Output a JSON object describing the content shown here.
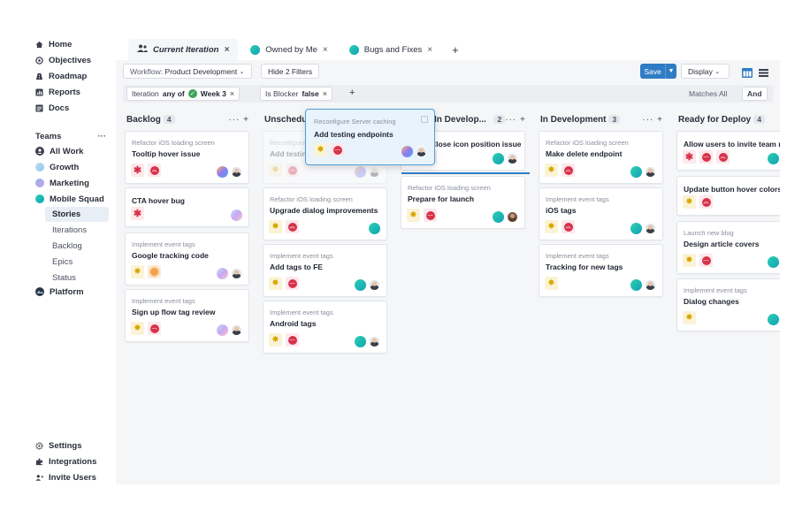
{
  "sidebar": {
    "nav": [
      {
        "label": "Home",
        "icon": "home-icon"
      },
      {
        "label": "Objectives",
        "icon": "target-icon"
      },
      {
        "label": "Roadmap",
        "icon": "roadmap-icon"
      },
      {
        "label": "Reports",
        "icon": "reports-icon"
      },
      {
        "label": "Docs",
        "icon": "docs-icon"
      }
    ],
    "teams_label": "Teams",
    "teams_more": "···",
    "teams": [
      {
        "label": "All Work",
        "icon": "team-icon"
      },
      {
        "label": "Growth",
        "color": "#9ecbea"
      },
      {
        "label": "Marketing",
        "color": "#c59be8"
      },
      {
        "label": "Mobile Squad",
        "color": "#17b8a6"
      }
    ],
    "squad_items": [
      "Stories",
      "Iterations",
      "Backlog",
      "Epics",
      "Status"
    ],
    "platform": {
      "label": "Platform",
      "icon": "platform-icon"
    },
    "footer": [
      {
        "label": "Settings",
        "icon": "gear-icon"
      },
      {
        "label": "Integrations",
        "icon": "puzzle-icon"
      },
      {
        "label": "Invite Users",
        "icon": "user-plus-icon"
      }
    ]
  },
  "tabs": [
    {
      "label": "Current Iteration",
      "active": true
    },
    {
      "label": "Owned by Me"
    },
    {
      "label": "Bugs and Fixes"
    }
  ],
  "tab_add": "+",
  "tab_close": "×",
  "toolbar": {
    "workflow_label": "Workflow:",
    "workflow_value": "Product Development",
    "hide_filters": "Hide 2 Filters",
    "save": "Save",
    "display": "Display"
  },
  "filters": {
    "iteration_label": "Iteration",
    "iteration_op": "any of",
    "iteration_value": "Week 3",
    "blocker_label": "Is Blocker",
    "blocker_value": "false",
    "add": "+",
    "matches": "Matches All",
    "and": "And"
  },
  "columns": [
    {
      "title": "Backlog",
      "count": "4",
      "cards": [
        {
          "sub": "Refactor iOS loading screen",
          "title": "Tooltip hover issue",
          "badges": [
            "bug",
            "priority"
          ],
          "people": [
            "grad-blue",
            "person"
          ]
        },
        {
          "sub": "",
          "title": "CTA hover bug",
          "badges": [
            "bug"
          ],
          "people": [
            "grad-pastel"
          ]
        },
        {
          "sub": "Implement event tags",
          "title": "Google tracking code",
          "badges": [
            "feature",
            "orange"
          ],
          "people": [
            "grad-pastel",
            "person"
          ]
        },
        {
          "sub": "Implement event tags",
          "title": "Sign up flow tag review",
          "badges": [
            "feature",
            "red"
          ],
          "people": [
            "grad-pastel",
            "person"
          ]
        }
      ]
    },
    {
      "title": "Unscheduled",
      "count": "",
      "cards": [
        {
          "sub": "Reconfigure Server caching",
          "title": "Add testing endpoints",
          "badges": [
            "feature",
            "red"
          ],
          "people": [
            "grad-blue",
            "person"
          ]
        },
        {
          "sub": "Refactor iOS loading screen",
          "title": "Upgrade dialog improvements",
          "badges": [
            "feature",
            "priority"
          ],
          "people": [
            "teal"
          ]
        },
        {
          "sub": "Implement event tags",
          "title": "Add tags to FE",
          "badges": [
            "feature",
            "red"
          ],
          "people": [
            "teal",
            "person"
          ]
        },
        {
          "sub": "Implement event tags",
          "title": "Android tags",
          "badges": [
            "feature",
            "red"
          ],
          "people": [
            "teal",
            "person"
          ]
        }
      ]
    },
    {
      "title": "In Develop...",
      "count": "2",
      "cards": [
        {
          "sub": "",
          "title": "Close icon position issue",
          "badges": [
            "bug",
            "red"
          ],
          "people": [
            "teal",
            "person"
          ]
        },
        {
          "sub": "Refactor iOS loading screen",
          "title": "Prepare for launch",
          "badges": [
            "feature",
            "red"
          ],
          "people": [
            "teal",
            "person-dark"
          ]
        }
      ]
    },
    {
      "title": "In Development",
      "count": "3",
      "cards": [
        {
          "sub": "Refactor iOS loading screen",
          "title": "Make delete endpoint",
          "badges": [
            "feature",
            "priority"
          ],
          "people": [
            "teal",
            "person"
          ]
        },
        {
          "sub": "Implement event tags",
          "title": "iOS tags",
          "badges": [
            "feature",
            "priority"
          ],
          "people": [
            "teal",
            "person"
          ]
        },
        {
          "sub": "Implement event tags",
          "title": "Tracking for new tags",
          "badges": [
            "feature"
          ],
          "people": [
            "teal",
            "person"
          ]
        }
      ]
    },
    {
      "title": "Ready for Deploy",
      "count": "4",
      "cards": [
        {
          "sub": "",
          "title": "Allow users to invite team m",
          "badges": [
            "bug",
            "red-num",
            "priority"
          ],
          "people": [
            "teal"
          ]
        },
        {
          "sub": "",
          "title": "Update button hover colors",
          "badges": [
            "feature",
            "priority"
          ],
          "people": []
        },
        {
          "sub": "Launch new blog",
          "title": "Design article covers",
          "badges": [
            "feature",
            "red"
          ],
          "people": [
            "teal"
          ]
        },
        {
          "sub": "Implement event tags",
          "title": "Dialog changes",
          "badges": [
            "feature"
          ],
          "people": [
            "teal"
          ]
        }
      ]
    }
  ],
  "drag_card": {
    "sub": "Reconfigure Server caching",
    "title": "Add testing endpoints"
  },
  "colors": {
    "accent": "#2f7cc4",
    "bug": "#d6334a",
    "feature": "#e0b400",
    "teal": "#17b8a6"
  }
}
